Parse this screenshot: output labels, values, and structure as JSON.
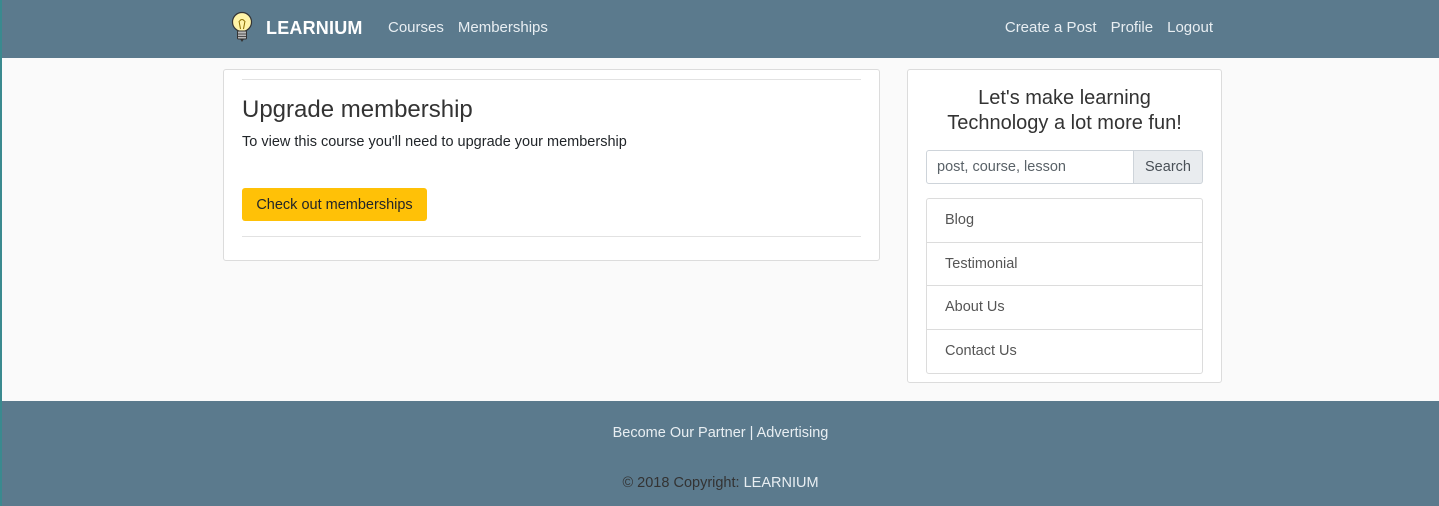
{
  "navbar": {
    "brand_icon": "lightbulb-icon",
    "brand_name": "LEARNIUM",
    "left_links": [
      "Courses",
      "Memberships"
    ],
    "right_links": [
      "Create a Post",
      "Profile",
      "Logout"
    ]
  },
  "main": {
    "title": "Upgrade membership",
    "message": "To view this course you'll need to upgrade your membership",
    "button_label": "Check out memberships"
  },
  "sidebar": {
    "tagline_line1": "Let's make learning",
    "tagline_line2": "Technology a lot more fun!",
    "search_placeholder": "post, course, lesson",
    "search_button": "Search",
    "links": [
      "Blog",
      "Testimonial",
      "About Us",
      "Contact Us"
    ]
  },
  "footer": {
    "partner_link": "Become Our Partner",
    "separator": " | ",
    "advertising_link": "Advertising",
    "copyright_prefix": "© 2018 Copyright: ",
    "copyright_brand": "LEARNIUM"
  },
  "colors": {
    "navbar_bg": "#5b7a8d",
    "accent_button": "#ffc107",
    "page_bg": "#fafafa"
  }
}
